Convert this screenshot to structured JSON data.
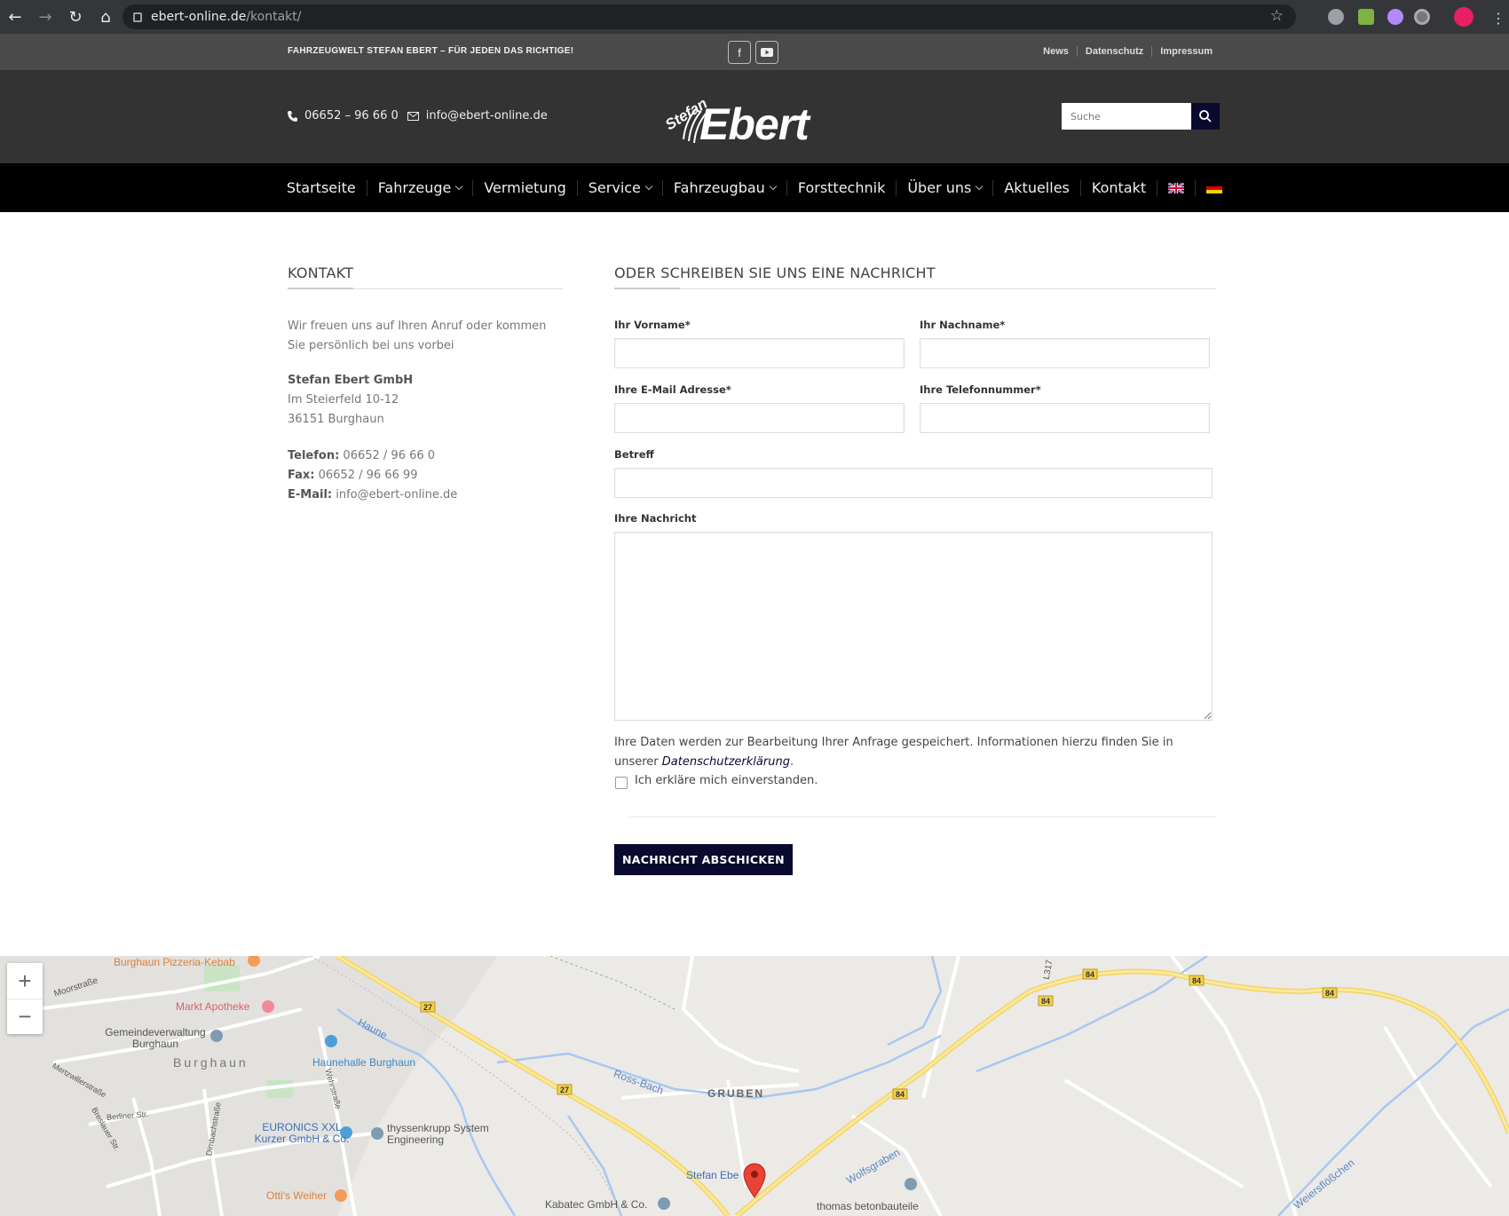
{
  "browser": {
    "url_host": "ebert-online.de",
    "url_path": "/kontakt/"
  },
  "topbar": {
    "tagline": "FAHRZEUGWELT STEFAN EBERT – FÜR JEDEN DAS RICHTIGE!",
    "links": [
      "News",
      "Datenschutz",
      "Impressum"
    ]
  },
  "header": {
    "phone": "06652 – 96 66 0",
    "email": "info@ebert-online.de",
    "logo_small": "Stefan",
    "logo_big": "Ebert",
    "search_placeholder": "Suche"
  },
  "nav": {
    "items": [
      "Startseite",
      "Fahrzeuge",
      "Vermietung",
      "Service",
      "Fahrzeugbau",
      "Forsttechnik",
      "Über uns",
      "Aktuelles",
      "Kontakt"
    ]
  },
  "kontakt": {
    "title": "KONTAKT",
    "intro": "Wir freuen uns auf Ihren Anruf oder kommen Sie persönlich bei uns vorbei",
    "company": "Stefan Ebert GmbH",
    "street": "Im Steierfeld 10-12",
    "city": "36151 Burghaun",
    "phone_label": "Telefon:",
    "phone": "06652 / 96 66 0",
    "fax_label": "Fax:",
    "fax": "06652 / 96 66 99",
    "email_label": "E-Mail:",
    "email": "info@ebert-online.de"
  },
  "form": {
    "title": "ODER SCHREIBEN SIE UNS EINE NACHRICHT",
    "firstname_label": "Ihr Vorname*",
    "lastname_label": "Ihr Nachname*",
    "email_label": "Ihre E-Mail Adresse*",
    "phone_label": "Ihre Telefonnummer*",
    "subject_label": "Betreff",
    "message_label": "Ihre Nachricht",
    "privacy_text": "Ihre Daten werden zur Bearbeitung Ihrer Anfrage gespeichert. Informationen hierzu finden Sie in unserer",
    "privacy_link": "Datenschutzerklärung",
    "privacy_end": ".",
    "consent": "Ich erkläre mich einverstanden.",
    "submit": "NACHRICHT ABSCHICKEN"
  },
  "map": {
    "labels": [
      "Burghaun Pizzeria-Kebab",
      "Moorstraße",
      "Markt Apotheke",
      "Gemeindeverwaltung Burghaun",
      "Burghaun",
      "Haunehalle Burghaun",
      "Haune",
      "EURONICS XXL Kurzer GmbH & Co.",
      "thyssenkrupp System Engineering",
      "Otti's Weiher",
      "Kabatec GmbH & Co.",
      "GRUBEN",
      "Ross-Bach",
      "Stefan Ebe",
      "Wolfsgraben",
      "thomas betonbauteile",
      "Weiersflößchen",
      "Berliner Str.",
      "Mertzwillerstraße",
      "Breslauer Str.",
      "Dimbachstraße",
      "Wehrstraße"
    ],
    "road_numbers": [
      "27",
      "27",
      "84",
      "84",
      "84",
      "84",
      "84",
      "L317"
    ]
  }
}
